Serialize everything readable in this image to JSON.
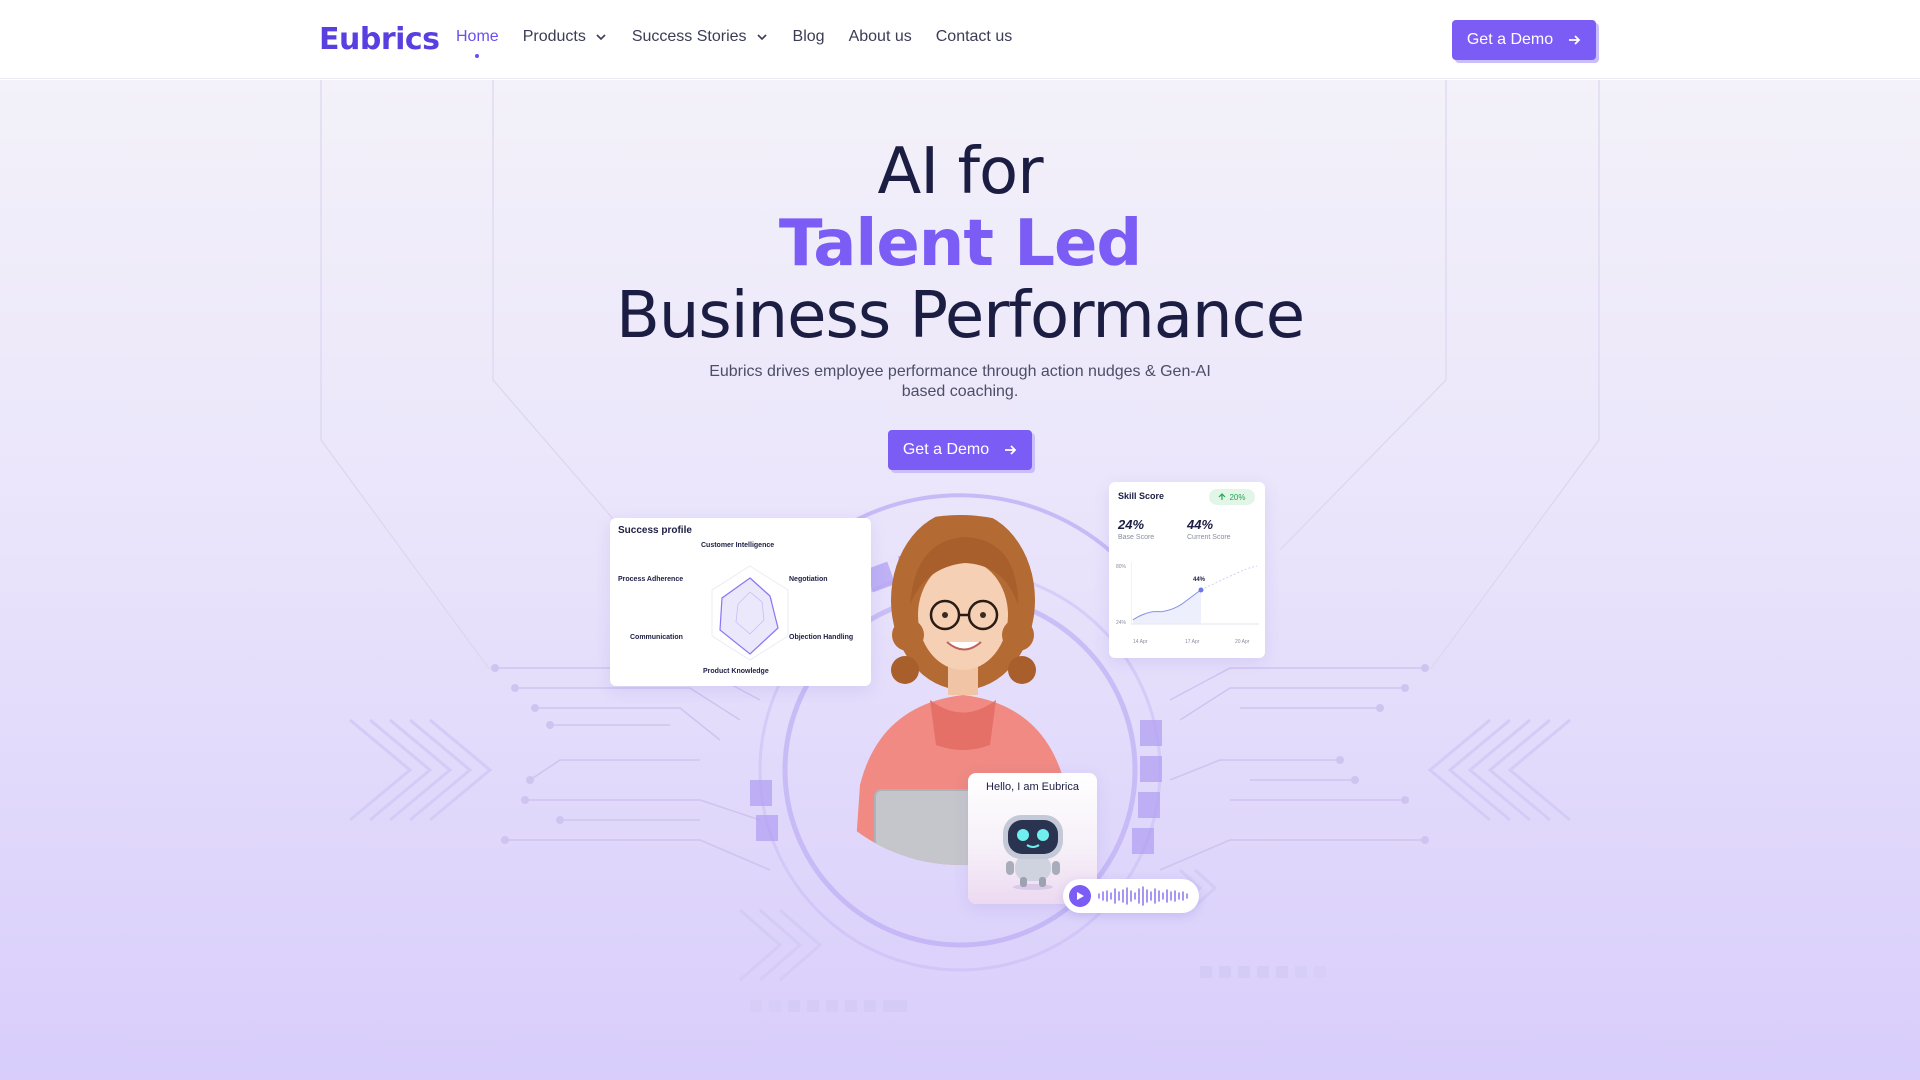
{
  "brand": {
    "logo": "Eubrics",
    "accent": "#7b5cf5"
  },
  "nav": {
    "items": [
      {
        "label": "Home",
        "active": true,
        "dropdown": false
      },
      {
        "label": "Products",
        "active": false,
        "dropdown": true
      },
      {
        "label": "Success Stories",
        "active": false,
        "dropdown": true
      },
      {
        "label": "Blog",
        "active": false,
        "dropdown": false
      },
      {
        "label": "About us",
        "active": false,
        "dropdown": false
      },
      {
        "label": "Contact us",
        "active": false,
        "dropdown": false
      }
    ],
    "cta": "Get a Demo"
  },
  "hero": {
    "line1": "AI for",
    "line2": "Talent Led",
    "line3": "Business Performance",
    "subtitle": "Eubrics drives employee performance through action nudges & Gen-AI based coaching.",
    "cta": "Get a Demo"
  },
  "success_profile": {
    "title": "Success profile",
    "labels": {
      "top": "Customer Intelligence",
      "top_left": "Process Adherence",
      "top_right": "Negotiation",
      "bottom_left": "Communication",
      "bottom_right": "Objection Handling",
      "bottom": "Product Knowledge"
    }
  },
  "skill_score": {
    "title": "Skill Score",
    "badge": "20%",
    "base_value": "24%",
    "base_label": "Base Score",
    "current_value": "44%",
    "current_label": "Current Score",
    "y_top": "80%",
    "y_bottom": "24%",
    "point_label": "44%",
    "x_labels": [
      "14 Apr",
      "17 Apr",
      "20 Apr"
    ]
  },
  "bot": {
    "greeting": "Hello, I am Eubrica"
  }
}
